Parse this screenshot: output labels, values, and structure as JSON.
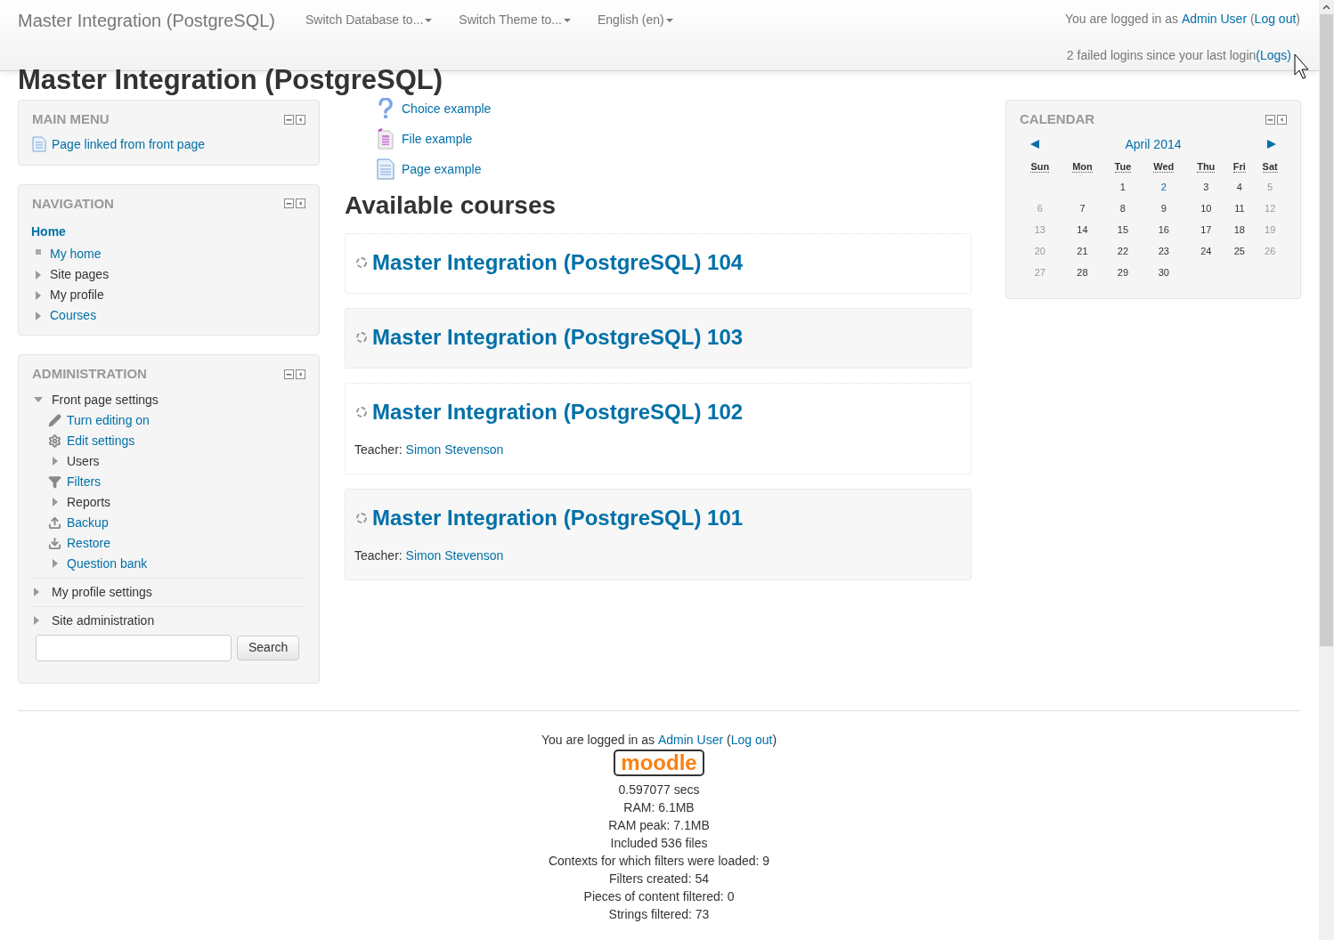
{
  "header": {
    "brand": "Master Integration (PostgreSQL)",
    "menus": [
      "Switch Database to...",
      "Switch Theme to...",
      "English (en)"
    ],
    "login": {
      "prefix": "You are logged in as ",
      "user": "Admin User",
      "open": " (",
      "logout": "Log out",
      "close": ")"
    },
    "failed": {
      "text": "2 failed logins since your last login",
      "link": "(Logs)"
    }
  },
  "page_title": "Master Integration (PostgreSQL)",
  "main_menu": {
    "title": "MAIN MENU",
    "items": [
      {
        "label": "Page linked from front page",
        "kind": "page"
      }
    ]
  },
  "navigation": {
    "title": "NAVIGATION",
    "home": "Home",
    "items": [
      {
        "label": "My home",
        "kind": "leaf",
        "link": true
      },
      {
        "label": "Site pages",
        "kind": "branch",
        "link": false
      },
      {
        "label": "My profile",
        "kind": "branch",
        "link": false
      },
      {
        "label": "Courses",
        "kind": "branch",
        "link": true
      }
    ]
  },
  "administration": {
    "title": "ADMINISTRATION",
    "sections": [
      {
        "label": "Front page settings",
        "expanded": true,
        "children": [
          {
            "label": "Turn editing on",
            "kind": "pencil",
            "link": true
          },
          {
            "label": "Edit settings",
            "kind": "gear",
            "link": true
          },
          {
            "label": "Users",
            "kind": "branch",
            "link": false
          },
          {
            "label": "Filters",
            "kind": "filter",
            "link": true
          },
          {
            "label": "Reports",
            "kind": "branch",
            "link": false
          },
          {
            "label": "Backup",
            "kind": "upload",
            "link": true
          },
          {
            "label": "Restore",
            "kind": "download",
            "link": true
          },
          {
            "label": "Question bank",
            "kind": "branch",
            "link": true
          }
        ]
      },
      {
        "label": "My profile settings",
        "expanded": false
      },
      {
        "label": "Site administration",
        "expanded": false
      }
    ],
    "search_button": "Search"
  },
  "activities": [
    {
      "label": "Choice example",
      "kind": "question"
    },
    {
      "label": "File example",
      "kind": "file"
    },
    {
      "label": "Page example",
      "kind": "page"
    }
  ],
  "courses_heading": "Available courses",
  "courses": [
    {
      "title": "Master Integration (PostgreSQL) 104"
    },
    {
      "title": "Master Integration (PostgreSQL) 103"
    },
    {
      "title": "Master Integration (PostgreSQL) 102",
      "teacher_label": "Teacher: ",
      "teacher": "Simon Stevenson"
    },
    {
      "title": "Master Integration (PostgreSQL) 101",
      "teacher_label": "Teacher: ",
      "teacher": "Simon Stevenson"
    }
  ],
  "calendar": {
    "title": "CALENDAR",
    "month": "April 2014",
    "weekdays": [
      "Sun",
      "Mon",
      "Tue",
      "Wed",
      "Thu",
      "Fri",
      "Sat"
    ],
    "weeks": [
      [
        {
          "day": "1",
          "kind": "weekday"
        },
        {
          "day": "2",
          "kind": "event"
        },
        {
          "day": "3",
          "kind": "weekday"
        },
        {
          "day": "4",
          "kind": "weekday"
        },
        {
          "day": "5",
          "kind": "weekend"
        }
      ],
      [
        {
          "day": "6",
          "kind": "weekend"
        },
        {
          "day": "7",
          "kind": "weekday"
        },
        {
          "day": "8",
          "kind": "weekday"
        },
        {
          "day": "9",
          "kind": "weekday"
        },
        {
          "day": "10",
          "kind": "weekday"
        },
        {
          "day": "11",
          "kind": "weekday"
        },
        {
          "day": "12",
          "kind": "weekend"
        }
      ],
      [
        {
          "day": "13",
          "kind": "weekend"
        },
        {
          "day": "14",
          "kind": "weekday"
        },
        {
          "day": "15",
          "kind": "weekday"
        },
        {
          "day": "16",
          "kind": "weekday"
        },
        {
          "day": "17",
          "kind": "weekday"
        },
        {
          "day": "18",
          "kind": "weekday"
        },
        {
          "day": "19",
          "kind": "weekend"
        }
      ],
      [
        {
          "day": "20",
          "kind": "weekend"
        },
        {
          "day": "21",
          "kind": "weekday"
        },
        {
          "day": "22",
          "kind": "weekday"
        },
        {
          "day": "23",
          "kind": "weekday"
        },
        {
          "day": "24",
          "kind": "weekday"
        },
        {
          "day": "25",
          "kind": "weekday"
        },
        {
          "day": "26",
          "kind": "weekend"
        }
      ],
      [
        {
          "day": "27",
          "kind": "weekend"
        },
        {
          "day": "28",
          "kind": "weekday"
        },
        {
          "day": "29",
          "kind": "weekday"
        },
        {
          "day": "30",
          "kind": "weekday"
        }
      ]
    ]
  },
  "footer": {
    "login": {
      "prefix": "You are logged in as ",
      "user": "Admin User",
      "open": " (",
      "logout": "Log out",
      "close": ")"
    },
    "logo": "moodle",
    "stats": [
      "0.597077 secs",
      "RAM: 6.1MB",
      "RAM peak: 7.1MB",
      "Included 536 files",
      "Contexts for which filters were loaded: 9",
      "Filters created: 54",
      "Pieces of content filtered: 0",
      "Strings filtered: 73"
    ]
  }
}
